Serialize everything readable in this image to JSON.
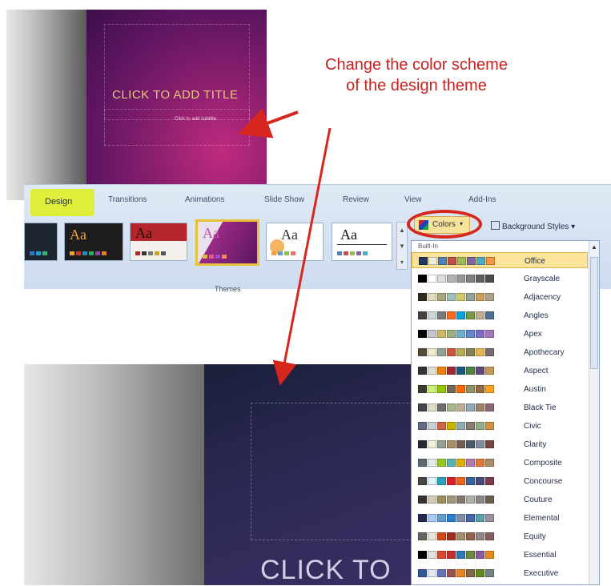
{
  "top_slide": {
    "title": "CLICK TO ADD TITLE",
    "subtitle": "Click to add subtitle"
  },
  "annotation": {
    "line1": "Change the color scheme",
    "line2": "of the design theme",
    "color": "#c8201e"
  },
  "ribbon": {
    "tabs": [
      "Design",
      "Transitions",
      "Animations",
      "Slide Show",
      "Review",
      "View",
      "Add-Ins"
    ],
    "active_tab": "Design",
    "group_label": "Themes",
    "thumb_text": "Aa",
    "colors_button": "Colors",
    "background_styles": "Background Styles",
    "highlight_color": "#dfee3a"
  },
  "bottom_slide": {
    "title": "CLICK TO"
  },
  "colors_menu": {
    "header": "Built-In",
    "items": [
      {
        "name": "Office",
        "selected": true,
        "swatches": [
          "#1f3864",
          "#eeece1",
          "#4f81bd",
          "#c0504d",
          "#9bbb59",
          "#8064a2",
          "#4bacc6",
          "#f79646"
        ]
      },
      {
        "name": "Grayscale",
        "swatches": [
          "#000000",
          "#ffffff",
          "#dddddd",
          "#b2b2b2",
          "#969696",
          "#808080",
          "#5f5f5f",
          "#4d4d4d"
        ]
      },
      {
        "name": "Adjacency",
        "swatches": [
          "#2f2b20",
          "#dfdcb7",
          "#a9a57c",
          "#9cbebd",
          "#d2cb6c",
          "#95a39d",
          "#c89f5d",
          "#b1a089"
        ]
      },
      {
        "name": "Angles",
        "swatches": [
          "#434342",
          "#cdd7d9",
          "#797b7e",
          "#f96a1b",
          "#08a1d9",
          "#7c984a",
          "#c2ad8d",
          "#506e94"
        ]
      },
      {
        "name": "Apex",
        "swatches": [
          "#000000",
          "#c9c2d1",
          "#ceb966",
          "#9cb084",
          "#6bb1c9",
          "#6585cf",
          "#7e6bc9",
          "#a379bb"
        ]
      },
      {
        "name": "Apothecary",
        "swatches": [
          "#564b3c",
          "#ecedd1",
          "#93a299",
          "#cf543f",
          "#b5ae53",
          "#848058",
          "#e8b54d",
          "#786c71"
        ]
      },
      {
        "name": "Aspect",
        "swatches": [
          "#323232",
          "#e3ded1",
          "#f07f09",
          "#9f2936",
          "#1b587c",
          "#4e8542",
          "#604878",
          "#c19859"
        ]
      },
      {
        "name": "Austin",
        "swatches": [
          "#3e3d2d",
          "#caf278",
          "#94c600",
          "#71685a",
          "#ff6700",
          "#909465",
          "#956b43",
          "#fea022"
        ]
      },
      {
        "name": "Black Tie",
        "swatches": [
          "#46464a",
          "#e3dcc8",
          "#6f6f74",
          "#a7b789",
          "#beae98",
          "#92a9b9",
          "#9c8265",
          "#8d6974"
        ]
      },
      {
        "name": "Civic",
        "swatches": [
          "#646b86",
          "#c5d1d7",
          "#d16349",
          "#ccb400",
          "#8cadae",
          "#8c7b70",
          "#8fb08c",
          "#d19049"
        ]
      },
      {
        "name": "Clarity",
        "swatches": [
          "#292934",
          "#f3f2dc",
          "#93a299",
          "#ad8f67",
          "#726056",
          "#4c5a6a",
          "#808da0",
          "#79463d"
        ]
      },
      {
        "name": "Composite",
        "swatches": [
          "#5b6973",
          "#e7ecec",
          "#98c723",
          "#59b0b9",
          "#deae00",
          "#b77bb4",
          "#e0773c",
          "#a98d63"
        ]
      },
      {
        "name": "Concourse",
        "swatches": [
          "#464646",
          "#def5fa",
          "#2da2bf",
          "#da1f28",
          "#eb641b",
          "#39639d",
          "#474b78",
          "#7d3c4a"
        ]
      },
      {
        "name": "Couture",
        "swatches": [
          "#37302a",
          "#d0ccb9",
          "#9e8e5c",
          "#a09781",
          "#85776d",
          "#aeafa9",
          "#8d878b",
          "#6b6149"
        ]
      },
      {
        "name": "Elemental",
        "swatches": [
          "#242852",
          "#accbf9",
          "#629dd1",
          "#297fd5",
          "#7f8fa9",
          "#4a66ac",
          "#5aa2ae",
          "#9d90a0"
        ]
      },
      {
        "name": "Equity",
        "swatches": [
          "#696464",
          "#e9e5dc",
          "#d34817",
          "#9b2d1f",
          "#a28e6a",
          "#956251",
          "#918485",
          "#855d5d"
        ]
      },
      {
        "name": "Essential",
        "swatches": [
          "#000000",
          "#e0e0e0",
          "#d94a2c",
          "#c32f2f",
          "#2e77b9",
          "#6e8a3c",
          "#8d5a9b",
          "#e28a1e"
        ]
      },
      {
        "name": "Executive",
        "swatches": [
          "#2f5897",
          "#e4e9ef",
          "#6076b4",
          "#9c5252",
          "#e68422",
          "#846648",
          "#63891f",
          "#758085"
        ]
      }
    ]
  }
}
